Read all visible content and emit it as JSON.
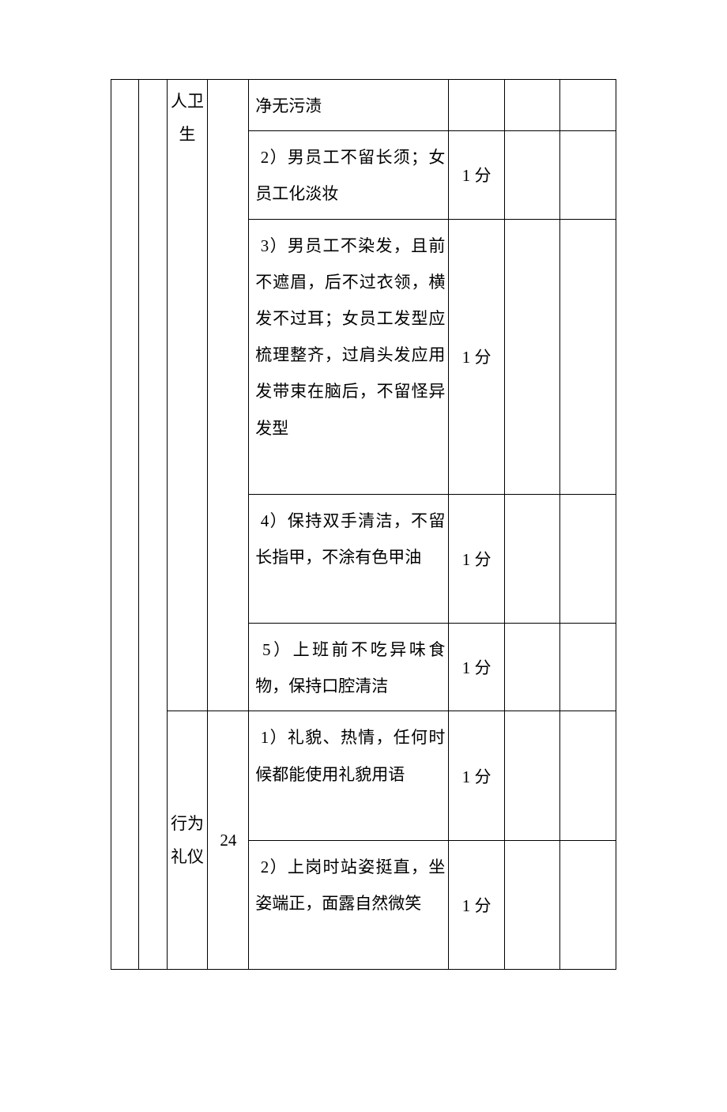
{
  "sections": {
    "hygiene": {
      "label_line1": "人卫",
      "label_line2": "生"
    },
    "etiquette": {
      "label_line1": "行为",
      "label_line2": "礼仪",
      "weight": "24"
    }
  },
  "rows": [
    {
      "criteria": "净无污渍",
      "score": ""
    },
    {
      "criteria": " 2）男员工不留长须；女员工化淡妆",
      "score": "1 分"
    },
    {
      "criteria": " 3）男员工不染发，且前不遮眉，后不过衣领，横发不过耳；女员工发型应梳理整齐，过肩头发应用发带束在脑后，不留怪异发型",
      "score": "1 分"
    },
    {
      "criteria": " 4）保持双手清洁，不留长指甲，不涂有色甲油",
      "score": "1 分"
    },
    {
      "criteria": " 5）上班前不吃异味食物，保持口腔清洁",
      "score": "1 分"
    },
    {
      "criteria": " 1）礼貌、热情，任何时候都能使用礼貌用语",
      "score": "1 分"
    },
    {
      "criteria": " 2）上岗时站姿挺直，坐姿端正，面露自然微笑",
      "score": "1 分"
    }
  ]
}
